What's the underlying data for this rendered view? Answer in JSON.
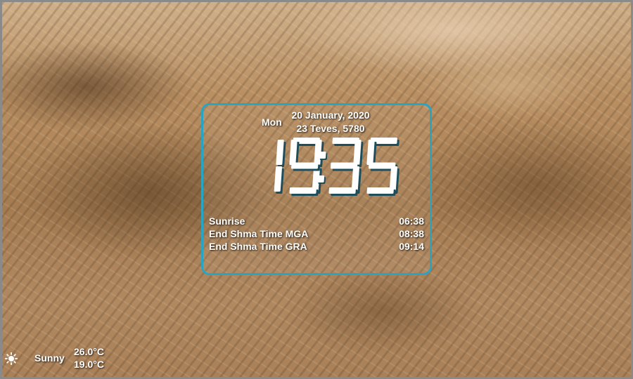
{
  "clock": {
    "day": "Mon",
    "gregorian_date": "20 January, 2020",
    "hebrew_date": "23 Teves, 5780",
    "time": "19:35"
  },
  "zmanim": [
    {
      "label": "Sunrise",
      "time": "06:38"
    },
    {
      "label": "End Shma Time MGA",
      "time": "08:38"
    },
    {
      "label": "End Shma Time GRA",
      "time": "09:14"
    }
  ],
  "weather": {
    "icon": "sun-icon",
    "condition": "Sunny",
    "high": "26.0°C",
    "low": "19.0°C"
  },
  "colors": {
    "panel_border": "#29a5c4",
    "clock_shadow": "#1f4e5a"
  }
}
